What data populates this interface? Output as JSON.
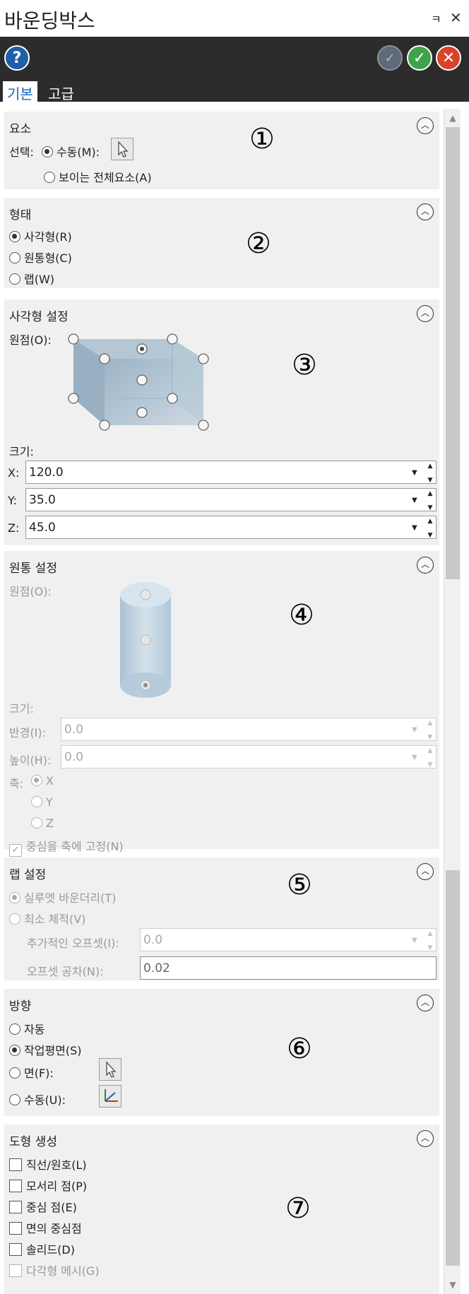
{
  "window": {
    "title": "바운딩박스",
    "pin_glyph": "ㅋ",
    "close_glyph": "✕"
  },
  "toolbar": {
    "help": "?",
    "apply_glyph": "✓",
    "ok_glyph": "✓",
    "cancel_glyph": "✕"
  },
  "tabs": [
    {
      "label": "기본",
      "active": true
    },
    {
      "label": "고급",
      "active": false
    }
  ],
  "panels": {
    "element": {
      "title": "요소",
      "number": "①",
      "select_label": "선택:",
      "manual": "수동(M):",
      "all_visible": "보이는 전체요소(A)"
    },
    "shape": {
      "title": "형태",
      "number": "②",
      "options": [
        "사각형(R)",
        "원통형(C)",
        "랩(W)"
      ]
    },
    "rect": {
      "title": "사각형 설정",
      "number": "③",
      "origin_label": "원점(O):",
      "size_label": "크기:",
      "x_label": "X:",
      "x_value": "120.0",
      "y_label": "Y:",
      "y_value": "35.0",
      "z_label": "Z:",
      "z_value": "45.0"
    },
    "cylinder": {
      "title": "원통 설정",
      "number": "④",
      "origin_label": "원점(O):",
      "size_label": "크기:",
      "radius_label": "반경(I):",
      "radius_value": "0.0",
      "height_label": "높이(H):",
      "height_value": "0.0",
      "axis_label": "축:",
      "axes": [
        "X",
        "Y",
        "Z"
      ],
      "fix_center": "중심을 축에 고정(N)"
    },
    "wrap": {
      "title": "랩 설정",
      "number": "⑤",
      "silhouette": "실루엣 바운더리(T)",
      "min_volume": "최소 체적(V)",
      "offset_label": "추가적인 오프셋(I):",
      "offset_value": "0.0",
      "tolerance_label": "오프셋 공차(N):",
      "tolerance_value": "0.02"
    },
    "direction": {
      "title": "방향",
      "number": "⑥",
      "auto": "자동",
      "workplane": "작업평면(S)",
      "face": "면(F):",
      "manual": "수동(U):"
    },
    "create": {
      "title": "도형 생성",
      "number": "⑦",
      "items": [
        "직선/원호(L)",
        "모서리 점(P)",
        "중심 점(E)",
        "면의 중심점",
        "솔리드(D)",
        "다각형 메시(G)"
      ]
    }
  }
}
